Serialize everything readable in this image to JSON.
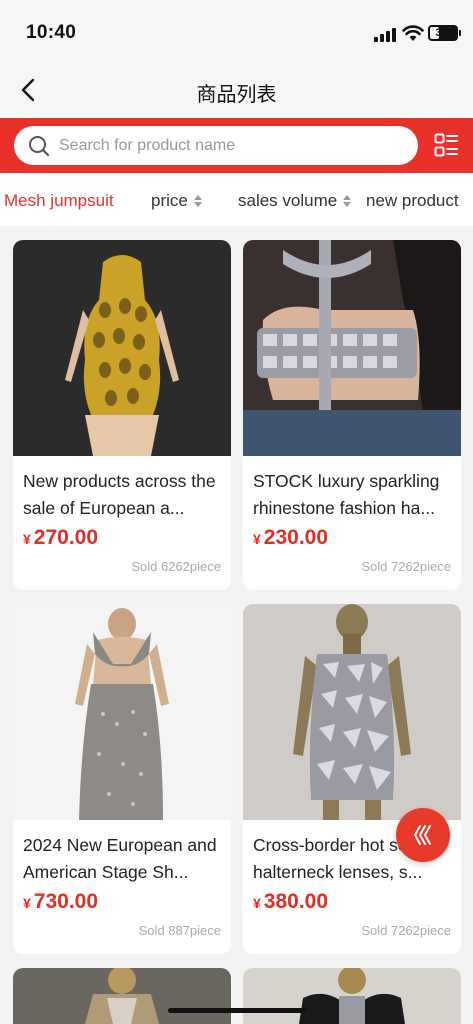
{
  "status_bar": {
    "time": "10:40",
    "battery": "37",
    "battery_level": 0.37
  },
  "header": {
    "title": "商品列表",
    "back_icon": "chevron-left-icon"
  },
  "search": {
    "placeholder": "Search for product name",
    "icon": "search-icon",
    "layout_icon": "grid-layout-icon"
  },
  "filters": [
    {
      "label": "Mesh jumpsuit",
      "active": true,
      "sortable": false
    },
    {
      "label": "price",
      "active": false,
      "sortable": true
    },
    {
      "label": "sales volume",
      "active": false,
      "sortable": true
    },
    {
      "label": "new product",
      "active": false,
      "sortable": false
    }
  ],
  "products": [
    {
      "title": "New products across the sale of European a...",
      "currency": "¥",
      "price": "270.00",
      "sold": "Sold 6262piece"
    },
    {
      "title": "STOCK luxury sparkling rhinestone fashion ha...",
      "currency": "¥",
      "price": "230.00",
      "sold": "Sold 7262piece"
    },
    {
      "title": "2024 New European and American Stage Sh...",
      "currency": "¥",
      "price": "730.00",
      "sold": "Sold 887piece"
    },
    {
      "title": "Cross-border hot selling halterneck lenses, s...",
      "currency": "¥",
      "price": "380.00",
      "sold": "Sold 7262piece"
    }
  ],
  "colors": {
    "accent": "#e7312a",
    "price": "#e02f22",
    "background": "#f3f3f3"
  },
  "float_button": {
    "icon": "chevron-left-triple-icon"
  }
}
